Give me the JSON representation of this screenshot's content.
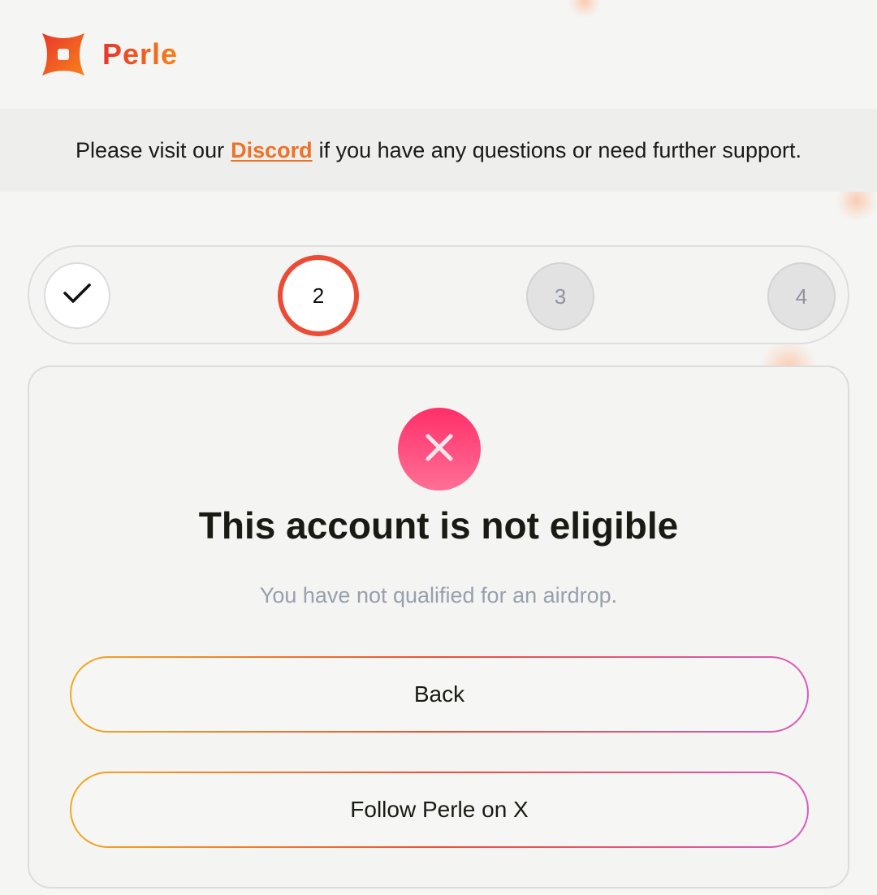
{
  "brand": {
    "name": "Perle",
    "logo_icon": "perle-logo-icon"
  },
  "notice": {
    "prefix": "Please visit our",
    "link_label": "Discord",
    "suffix": "if you have any questions or need further support."
  },
  "stepper": {
    "steps": [
      {
        "label": "",
        "state": "completed",
        "icon": "check-icon"
      },
      {
        "label": "2",
        "state": "current"
      },
      {
        "label": "3",
        "state": "upcoming"
      },
      {
        "label": "4",
        "state": "upcoming"
      }
    ]
  },
  "result": {
    "icon": "close-icon",
    "title": "This account is not eligible",
    "message": "You have not qualified for an airdrop."
  },
  "actions": {
    "back_label": "Back",
    "follow_label": "Follow Perle on X"
  },
  "colors": {
    "brand_orange": "#ee7226",
    "step_active_ring": "#ec4b35",
    "error_badge_top": "#ff2f6a",
    "error_badge_bottom": "#ff6f96",
    "button_gradient": [
      "#f4a81f",
      "#ec5035",
      "#d95cbd"
    ]
  }
}
